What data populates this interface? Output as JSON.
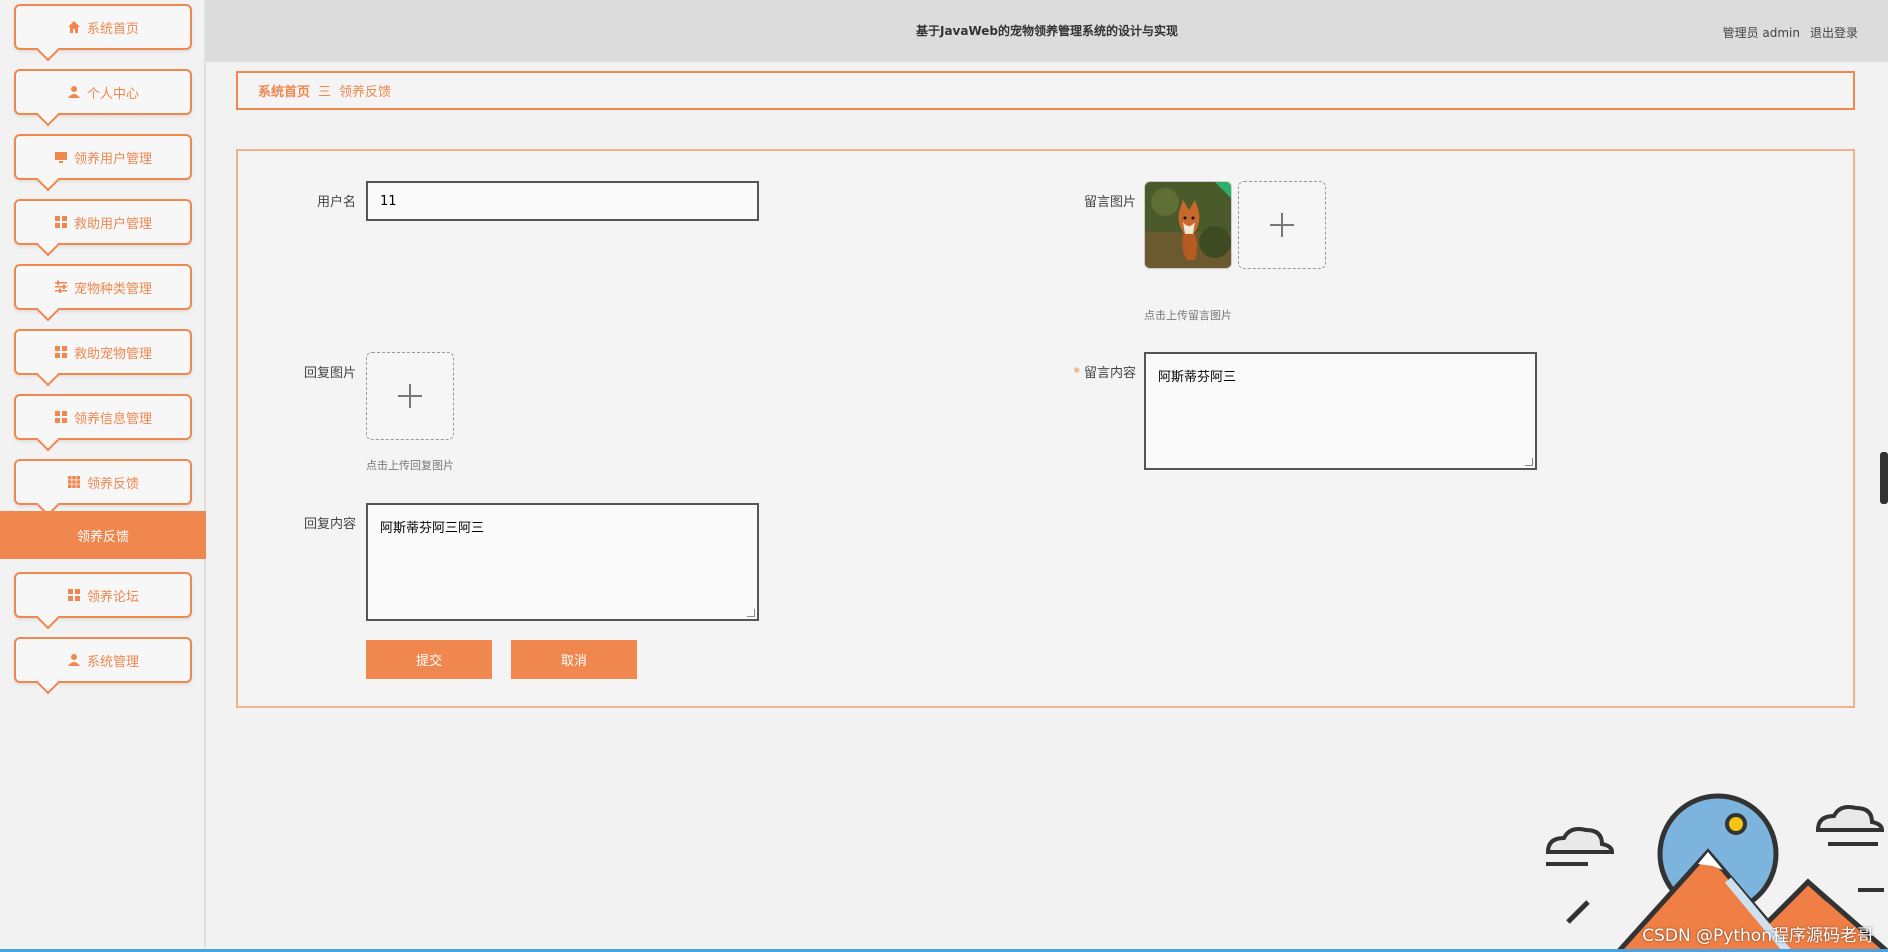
{
  "header": {
    "title": "基于JavaWeb的宠物领养管理系统的设计与实现",
    "admin_label": "管理员 admin",
    "logout_label": "退出登录"
  },
  "sidebar": {
    "items": [
      {
        "label": "系统首页",
        "icon": "home-icon"
      },
      {
        "label": "个人中心",
        "icon": "user-icon"
      },
      {
        "label": "领养用户管理",
        "icon": "monitor-icon"
      },
      {
        "label": "救助用户管理",
        "icon": "grid-icon"
      },
      {
        "label": "宠物种类管理",
        "icon": "sliders-icon"
      },
      {
        "label": "救助宠物管理",
        "icon": "grid-icon"
      },
      {
        "label": "领养信息管理",
        "icon": "grid-icon"
      },
      {
        "label": "领养反馈",
        "icon": "table-icon"
      },
      {
        "label": "领养论坛",
        "icon": "grid-icon"
      },
      {
        "label": "系统管理",
        "icon": "user-icon"
      }
    ],
    "active_sub_item": "领养反馈"
  },
  "breadcrumb": {
    "home": "系统首页",
    "separator": "三",
    "current": "领养反馈"
  },
  "form": {
    "username_label": "用户名",
    "username_value": "11",
    "message_image_label": "留言图片",
    "message_image_hint": "点击上传留言图片",
    "reply_image_label": "回复图片",
    "reply_image_hint": "点击上传回复图片",
    "message_content_label": "留言内容",
    "message_content_value": "阿斯蒂芬阿三",
    "reply_content_label": "回复内容",
    "reply_content_value": "阿斯蒂芬阿三阿三",
    "submit_label": "提交",
    "cancel_label": "取消"
  },
  "watermark": "CSDN @Python程序源码老哥",
  "colors": {
    "accent": "#f0874f",
    "header_bg": "#dcdcdc",
    "page_bg": "#f2f2f2"
  }
}
